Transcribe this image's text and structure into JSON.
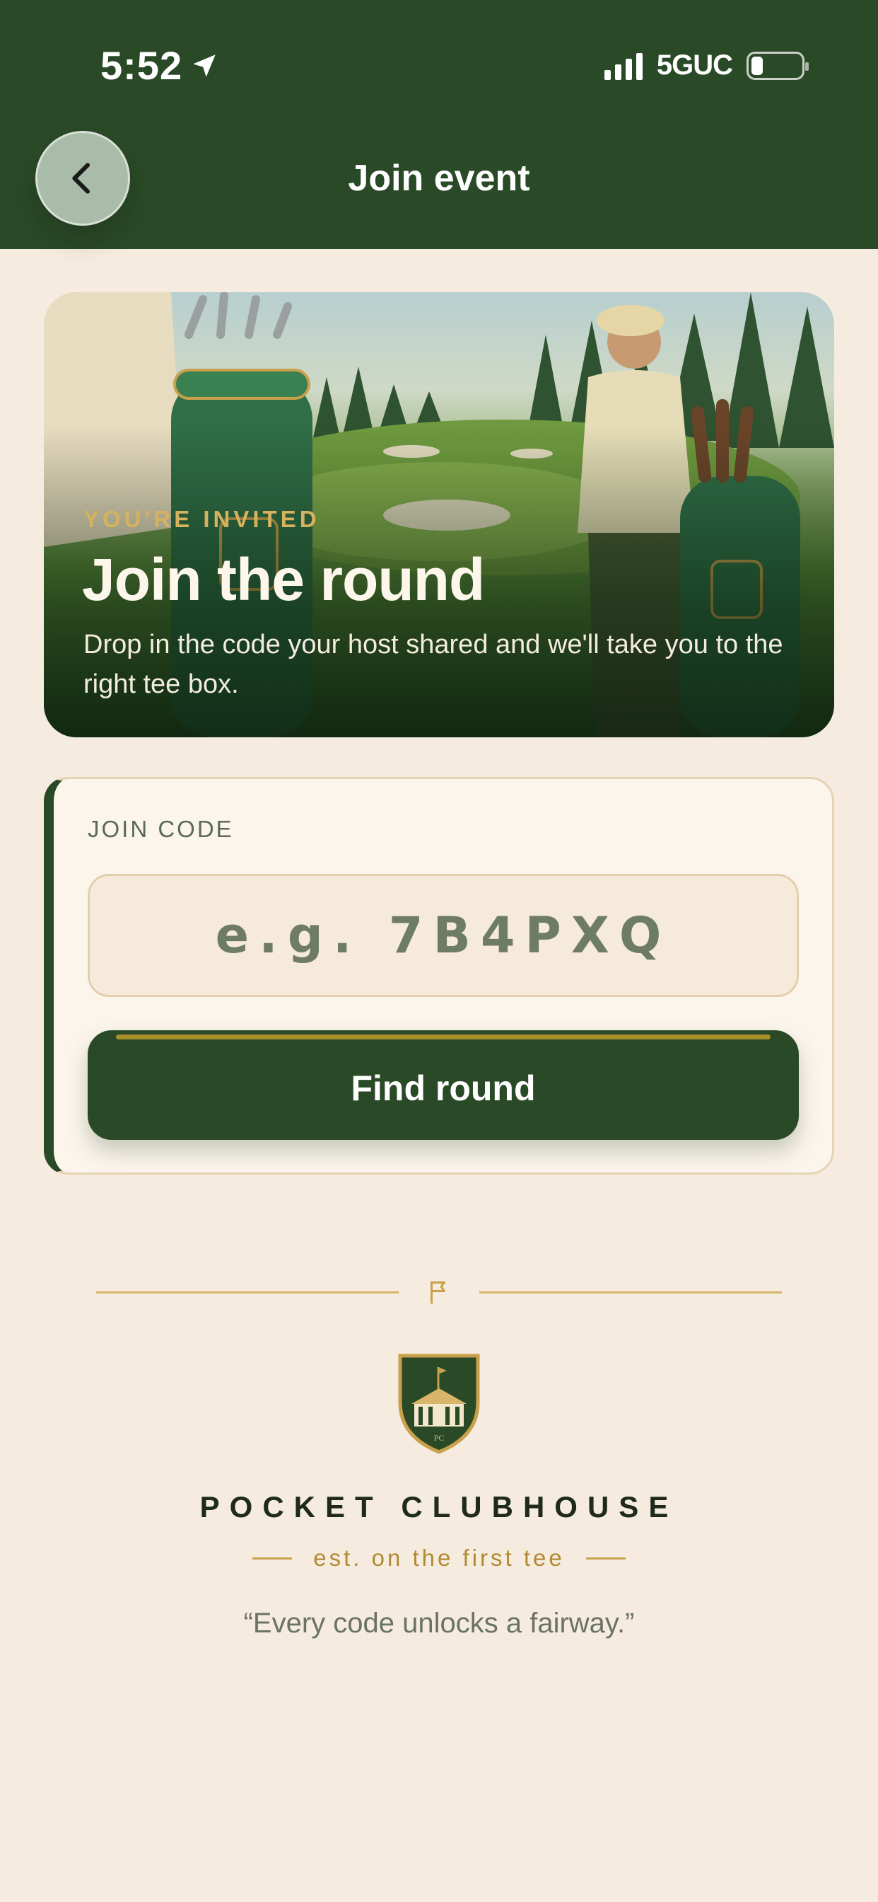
{
  "status_bar": {
    "time": "5:52",
    "network": "5GUC",
    "battery_level": 0.2
  },
  "header": {
    "title": "Join event",
    "back_icon": "chevron-left-icon"
  },
  "hero": {
    "eyebrow": "YOU'RE INVITED",
    "title": "Join the round",
    "subtitle": "Drop in the code your host shared and we'll take you to the right tee box."
  },
  "join": {
    "label": "JOIN CODE",
    "input_value": "",
    "input_placeholder": "e.g. 7B4PXQ",
    "button_label": "Find round"
  },
  "footer": {
    "divider_icon": "flag-icon",
    "crest_icon": "clubhouse-crest-icon",
    "crest_text": "PC",
    "brand": "POCKET CLUBHOUSE",
    "tagline": "est. on the first tee",
    "quote": "“Every code unlocks a fairway.”"
  },
  "colors": {
    "primary_green": "#2a4a27",
    "background": "#f5ecdf",
    "gold": "#c9a04b"
  }
}
